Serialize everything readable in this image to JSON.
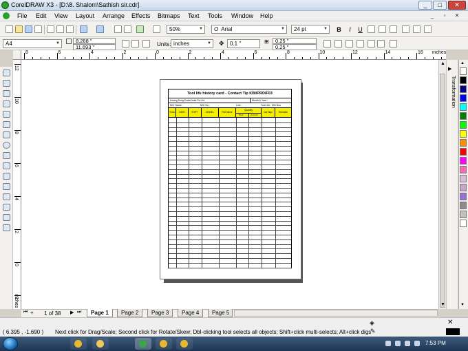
{
  "window": {
    "title": "CorelDRAW X3 - [D:\\8. Shalom\\Sathish sir.cdr]",
    "controls": {
      "minimize": "_",
      "maximize": "□",
      "close": "✕"
    }
  },
  "menu": {
    "items": [
      "File",
      "Edit",
      "View",
      "Layout",
      "Arrange",
      "Effects",
      "Bitmaps",
      "Text",
      "Tools",
      "Window",
      "Help"
    ],
    "mdi_controls": {
      "minimize": "_",
      "restore": "▫",
      "close": "✕"
    }
  },
  "standard_toolbar": {
    "zoom": "50%",
    "font_name": "Arial",
    "font_size": "24 pt",
    "format_buttons": [
      "B",
      "I",
      "U"
    ]
  },
  "property_bar": {
    "paper_size": "A4",
    "width": "8.268 \"",
    "height": "11.693 \"",
    "units_label": "Units:",
    "units_value": "inches",
    "nudge": "0.1 \"",
    "dup_x": "0.25 \"",
    "dup_y": "0.25 \""
  },
  "ruler": {
    "horizontal_labels": [
      "8",
      "6",
      "4",
      "2",
      "0",
      "2",
      "4",
      "6",
      "8",
      "10",
      "12",
      "14",
      "16"
    ],
    "unit": "inches",
    "vertical_labels": [
      "12",
      "10",
      "8",
      "6",
      "4",
      "2",
      "0",
      "2"
    ],
    "vertical_unit": "inches"
  },
  "document": {
    "title": "Tool life history card - Contact Tip KBI/PRD/F03",
    "company": "Kwang Sung Exata India Pvt Ltd",
    "month_year_label": "Month & Year :",
    "mc_name_label": "M/C Name :",
    "mc_no_label": "M/C No :",
    "line_label": "Line :",
    "tool_life_label": "Tool Life : 500 Nos",
    "quantity_label": "Quantity",
    "columns": [
      "S.No",
      "DATE",
      "SHIFT",
      "MODEL",
      "Part Name",
      "Prod",
      "Cum.Int",
      "Opr.Sign",
      "Remarks"
    ]
  },
  "docker": {
    "tab_label": "Transformation"
  },
  "palette": {
    "colors": [
      "#ffffff",
      "#000000",
      "#00008b",
      "#0000ff",
      "#00ffff",
      "#008000",
      "#00ff00",
      "#ffff00",
      "#ff8c00",
      "#ff0000",
      "#ff00ff",
      "#ff69b4",
      "#d8bfd8",
      "#c8a2c8",
      "#9370db",
      "#8b8b8b",
      "#c0c0c0",
      "#ffffff"
    ]
  },
  "page_nav": {
    "counter": "1 of 38",
    "tabs": [
      "Page 1",
      "Page 2",
      "Page 3",
      "Page 4",
      "Page 5"
    ],
    "active_tab": "Page 1"
  },
  "status": {
    "coords": "( 6.395 , -1.690 )",
    "hint": "Next click for Drag/Scale; Second click for Rotate/Skew; Dbl-clicking tool selects all objects; Shift+click multi-selects; Alt+click digs"
  },
  "taskbar": {
    "clock": "7:53 PM",
    "apps": [
      "chrome-icon",
      "explorer-icon",
      "coreldraw-icon",
      "chrome-icon",
      "chrome-icon"
    ]
  }
}
